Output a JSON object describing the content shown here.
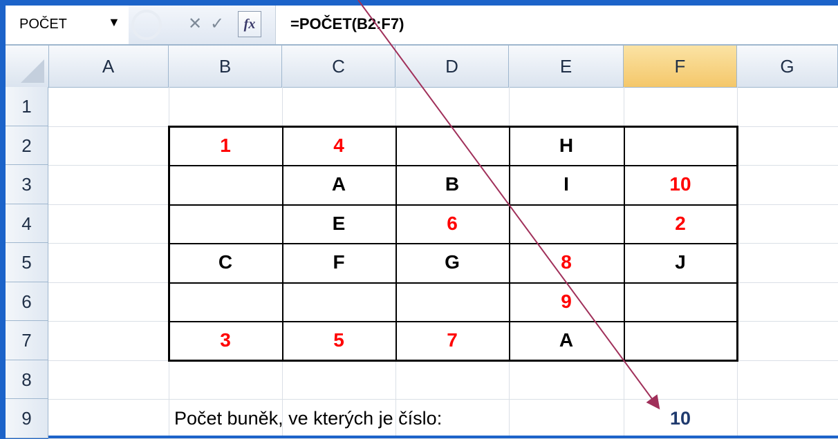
{
  "formula_bar": {
    "name_box": "POČET",
    "name_box_arrow": "▼",
    "cancel_glyph": "✕",
    "enter_glyph": "✓",
    "fx_label": "fx",
    "formula": "=POČET(B2:F7)"
  },
  "columns": [
    "A",
    "B",
    "C",
    "D",
    "E",
    "F",
    "G"
  ],
  "selected_column": "F",
  "rows": [
    "1",
    "2",
    "3",
    "4",
    "5",
    "6",
    "7",
    "8",
    "9"
  ],
  "cells": [
    {
      "ref": "B2",
      "value": "1",
      "color": "#ff0000"
    },
    {
      "ref": "C2",
      "value": "4",
      "color": "#ff0000"
    },
    {
      "ref": "E2",
      "value": "H",
      "color": "#000000"
    },
    {
      "ref": "C3",
      "value": "A",
      "color": "#000000"
    },
    {
      "ref": "D3",
      "value": "B",
      "color": "#000000"
    },
    {
      "ref": "E3",
      "value": "I",
      "color": "#000000"
    },
    {
      "ref": "F3",
      "value": "10",
      "color": "#ff0000"
    },
    {
      "ref": "C4",
      "value": "E",
      "color": "#000000"
    },
    {
      "ref": "D4",
      "value": "6",
      "color": "#ff0000"
    },
    {
      "ref": "F4",
      "value": "2",
      "color": "#ff0000"
    },
    {
      "ref": "B5",
      "value": "C",
      "color": "#000000"
    },
    {
      "ref": "C5",
      "value": "F",
      "color": "#000000"
    },
    {
      "ref": "D5",
      "value": "G",
      "color": "#000000"
    },
    {
      "ref": "E5",
      "value": "8",
      "color": "#ff0000"
    },
    {
      "ref": "F5",
      "value": "J",
      "color": "#000000"
    },
    {
      "ref": "E6",
      "value": "9",
      "color": "#ff0000"
    },
    {
      "ref": "B7",
      "value": "3",
      "color": "#ff0000"
    },
    {
      "ref": "C7",
      "value": "5",
      "color": "#ff0000"
    },
    {
      "ref": "D7",
      "value": "7",
      "color": "#ff0000"
    },
    {
      "ref": "E7",
      "value": "A",
      "color": "#000000"
    }
  ],
  "label_row9": "Počet buněk, ve kterých je číslo:",
  "result_F9": "10",
  "colors": {
    "accent_arrow": "#a0305a",
    "background": "#1c63c9",
    "selected_header": "#f4c76a"
  }
}
